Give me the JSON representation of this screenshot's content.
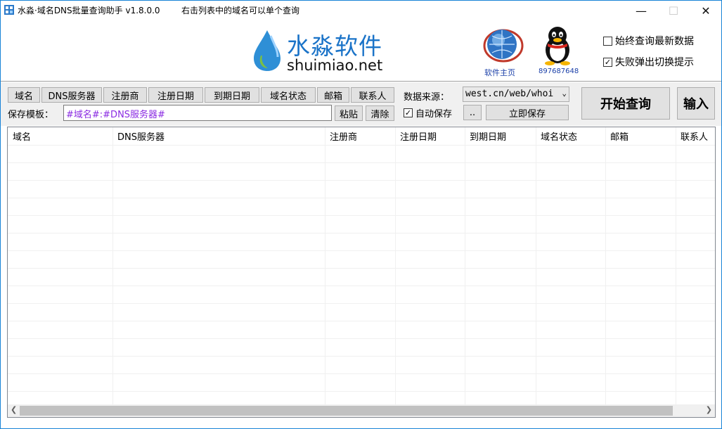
{
  "window": {
    "title": "水淼·域名DNS批量查询助手 v1.8.0.0",
    "hint": "右击列表中的域名可以单个查询",
    "minimize": "—",
    "maximize": "☐",
    "close": "✕"
  },
  "header": {
    "logo_title": "水淼软件",
    "logo_sub": "shuimiao.net",
    "home_label": "软件主页",
    "qq_label": "897687648",
    "always_query_latest": {
      "label": "始终查询最新数据",
      "checked": false
    },
    "popup_on_fail": {
      "label": "失败弹出切换提示",
      "checked": true
    }
  },
  "toolbar": {
    "field_buttons": [
      "域名",
      "DNS服务器",
      "注册商",
      "注册日期",
      "到期日期",
      "域名状态",
      "邮箱",
      "联系人"
    ],
    "save_template_label": "保存模板：",
    "save_template_value": "#域名#:#DNS服务器#",
    "paste_label": "粘贴",
    "clear_label": "清除",
    "source_label": "数据来源：",
    "source_value": "west.cn/web/whoi",
    "auto_save_label": "自动保存",
    "auto_save_checked": true,
    "browse_label": "..",
    "save_now_label": "立即保存",
    "start_query_label": "开始查询",
    "input_label": "输入"
  },
  "grid": {
    "columns": [
      "域名",
      "DNS服务器",
      "注册商",
      "注册日期",
      "到期日期",
      "域名状态",
      "邮箱",
      "联系人"
    ],
    "rows": []
  },
  "colors": {
    "accent": "#1a73c8",
    "link": "#1a3fa8",
    "template_text": "#8a2be2",
    "window_border": "#1883d7"
  }
}
